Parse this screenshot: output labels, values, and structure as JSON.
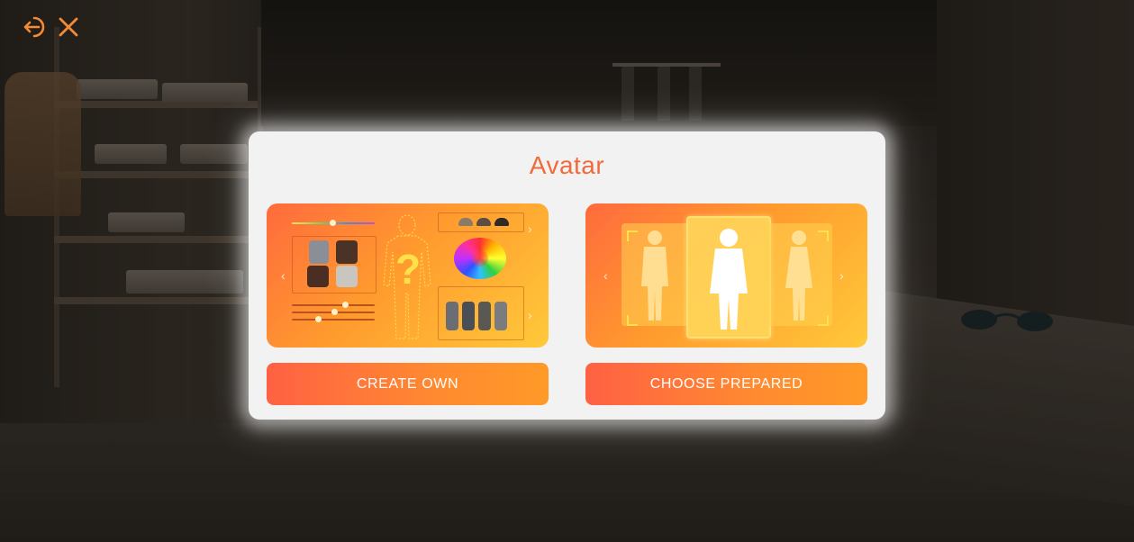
{
  "dialog": {
    "title": "Avatar",
    "create_own_label": "CREATE OWN",
    "choose_prepared_label": "CHOOSE PREPARED"
  },
  "cards": {
    "create_own": {
      "question_mark": "?",
      "arrow_left": "‹",
      "arrow_right": "›"
    },
    "choose_prepared": {
      "arrow_left": "‹",
      "arrow_right": "›"
    }
  },
  "icons": [
    "exit-icon",
    "close-icon"
  ],
  "colors": {
    "accent": "#f06a3a",
    "button_start": "#ff6143",
    "button_end": "#ff9a28",
    "dialog_bg": "#f2f2f2"
  }
}
